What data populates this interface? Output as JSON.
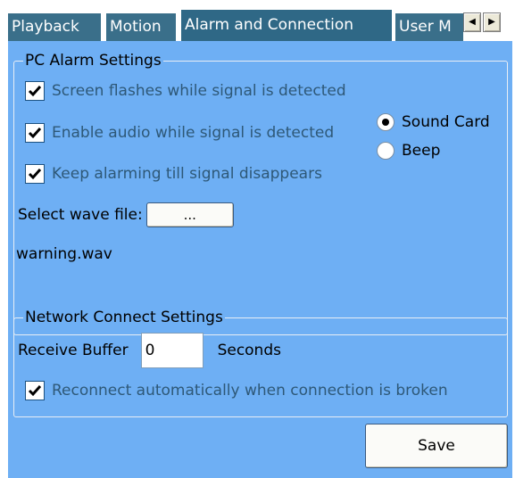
{
  "tabs": [
    {
      "label": "Playback",
      "active": false
    },
    {
      "label": "Motion",
      "active": false
    },
    {
      "label": "Alarm and Connection",
      "active": true
    },
    {
      "label": "User M",
      "active": false
    }
  ],
  "tab_scroll": {
    "left_icon": "◀",
    "right_icon": "▶"
  },
  "pc_alarm": {
    "title": "PC Alarm Settings",
    "screen_flash": {
      "label": "Screen flashes while signal is detected",
      "checked": true
    },
    "enable_audio": {
      "label": "Enable audio while signal is detected",
      "checked": true
    },
    "audio_source": {
      "options": [
        {
          "label": "Sound Card",
          "selected": true
        },
        {
          "label": "Beep",
          "selected": false
        }
      ]
    },
    "keep_alarming": {
      "label": "Keep alarming till signal disappears",
      "checked": true
    },
    "wave_file_label": "Select wave file:",
    "browse_label": "...",
    "wave_file_name": "warning.wav"
  },
  "network": {
    "title": "Network Connect Settings",
    "receive_buffer_label": "Receive Buffer",
    "receive_buffer_value": "0",
    "seconds_label": "Seconds",
    "reconnect": {
      "label": "Reconnect automatically when connection is broken",
      "checked": true
    }
  },
  "save_label": "Save",
  "colors": {
    "panel_bg": "#6eaff4",
    "tab_bg": "#3a6f8a",
    "checkbox_label": "#2e5877"
  }
}
